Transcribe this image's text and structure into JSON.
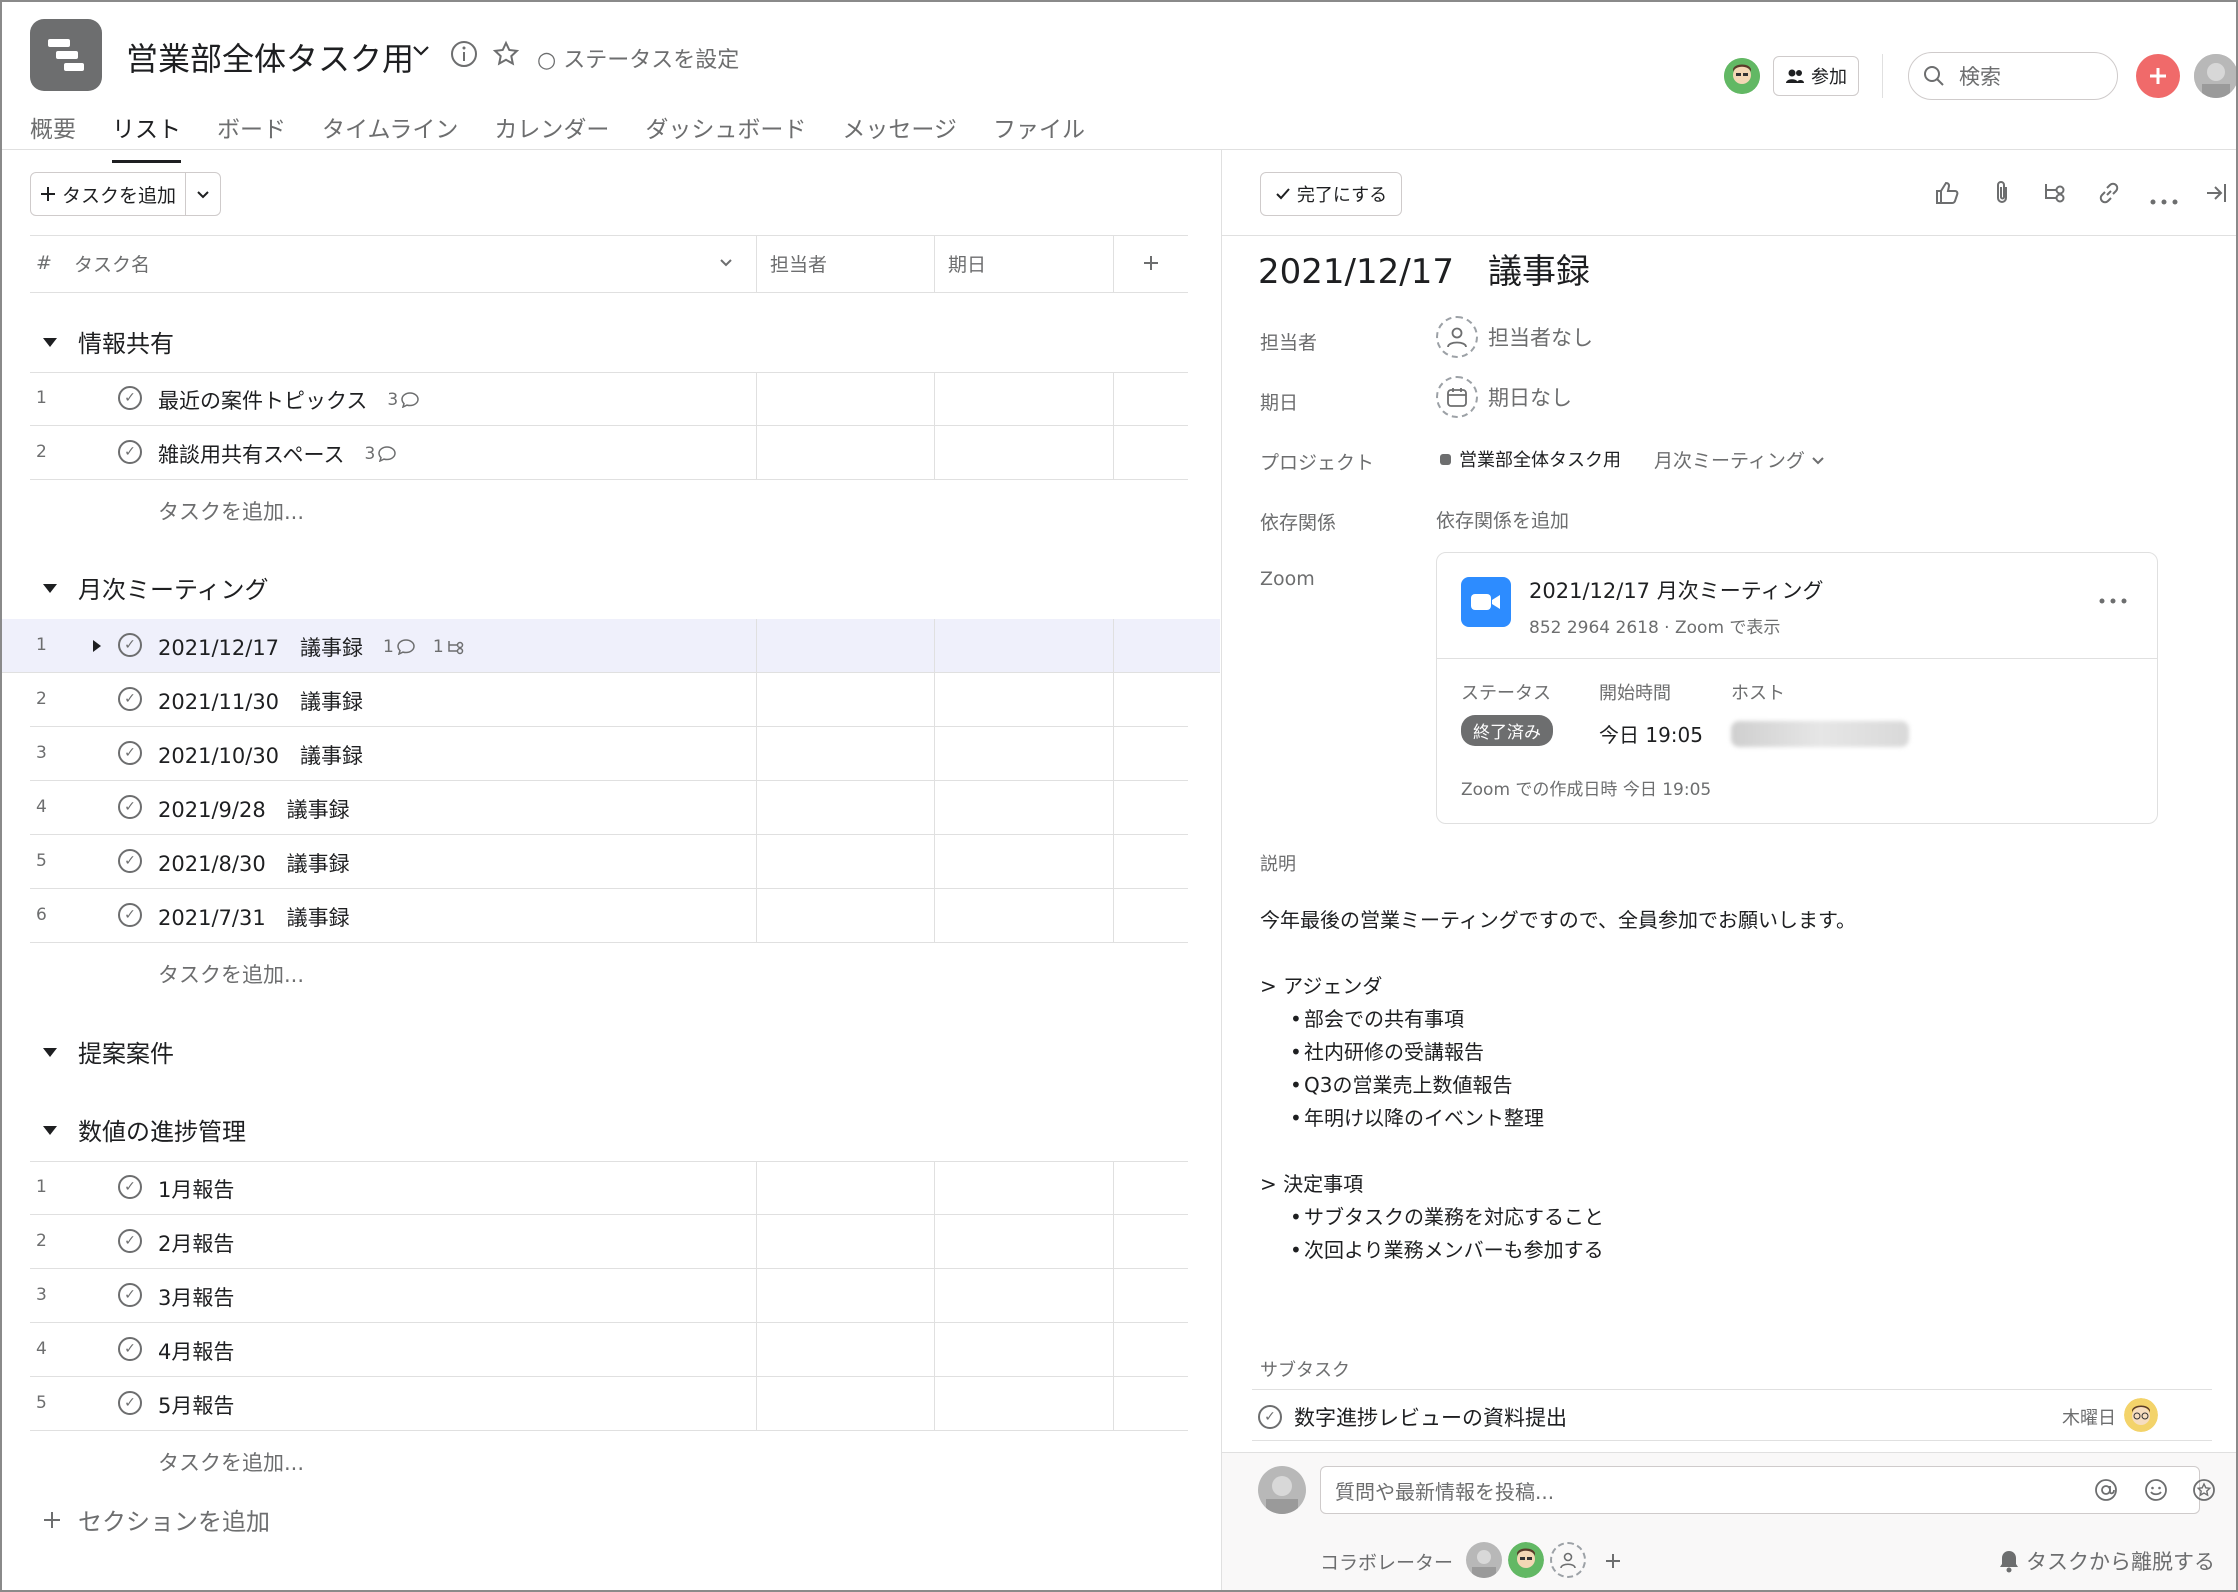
{
  "header": {
    "project_title": "営業部全体タスク用",
    "status_label": "ステータスを設定",
    "join_label": "参加",
    "search_placeholder": "検索",
    "tabs": [
      "概要",
      "リスト",
      "ボード",
      "タイムライン",
      "カレンダー",
      "ダッシュボード",
      "メッセージ",
      "ファイル"
    ],
    "active_tab": "リスト"
  },
  "list": {
    "add_task_label": "タスクを追加",
    "columns": {
      "task_name": "タスク名",
      "assignee": "担当者",
      "due": "期日",
      "hash": "#"
    },
    "add_task_inline": "タスクを追加...",
    "add_section_label": "セクションを追加",
    "sections": [
      {
        "name": "情報共有",
        "tasks": [
          {
            "num": "1",
            "name": "最近の案件トピックス",
            "comments": "3"
          },
          {
            "num": "2",
            "name": "雑談用共有スペース",
            "comments": "3"
          }
        ]
      },
      {
        "name": "月次ミーティング",
        "tasks": [
          {
            "num": "1",
            "name": "2021/12/17　議事録",
            "comments": "1",
            "subtasks": "1"
          },
          {
            "num": "2",
            "name": "2021/11/30　議事録"
          },
          {
            "num": "3",
            "name": "2021/10/30　議事録"
          },
          {
            "num": "4",
            "name": "2021/9/28　議事録"
          },
          {
            "num": "5",
            "name": "2021/8/30　議事録"
          },
          {
            "num": "6",
            "name": "2021/7/31　議事録"
          }
        ]
      },
      {
        "name": "提案案件",
        "tasks": []
      },
      {
        "name": "数値の進捗管理",
        "tasks": [
          {
            "num": "1",
            "name": "1月報告"
          },
          {
            "num": "2",
            "name": "2月報告"
          },
          {
            "num": "3",
            "name": "3月報告"
          },
          {
            "num": "4",
            "name": "4月報告"
          },
          {
            "num": "5",
            "name": "5月報告"
          }
        ]
      }
    ]
  },
  "detail": {
    "complete_label": "完了にする",
    "title": "2021/12/17　議事録",
    "assignee_label": "担当者",
    "assignee_value": "担当者なし",
    "due_label": "期日",
    "due_value": "期日なし",
    "project_label": "プロジェクト",
    "project_name": "営業部全体タスク用",
    "project_section": "月次ミーティング",
    "dependency_label": "依存関係",
    "dependency_add": "依存関係を追加",
    "zoom_label": "Zoom",
    "zoom": {
      "title": "2021/12/17 月次ミーティング",
      "subtitle": "852 2964 2618 · Zoom で表示",
      "status_label": "ステータス",
      "status_value": "終了済み",
      "start_label": "開始時間",
      "start_value": "今日 19:05",
      "host_label": "ホスト",
      "created": "Zoom での作成日時 今日 19:05"
    },
    "description_label": "説明",
    "description": {
      "intro": "今年最後の営業ミーティングですので、全員参加でお願いします。",
      "agenda_head": "> アジェンダ",
      "agenda": [
        "部会での共有事項",
        "社内研修の受講報告",
        "Q3の営業売上数値報告",
        "年明け以降のイベント整理"
      ],
      "decision_head": "> 決定事項",
      "decisions": [
        "サブタスクの業務を対応すること",
        "次回より業務メンバーも参加する"
      ]
    },
    "subtask_label": "サブタスク",
    "subtask_name": "数字進捗レビューの資料提出",
    "subtask_due": "木曜日",
    "comment_placeholder": "質問や最新情報を投稿...",
    "collaborators_label": "コラボレーター",
    "leave_label": "タスクから離脱する"
  },
  "colors": {
    "accent_red": "#f06a6a",
    "selected_row": "#eff0fb",
    "zoom_blue": "#2d8cff",
    "badge_gray": "#6d6e6f"
  }
}
